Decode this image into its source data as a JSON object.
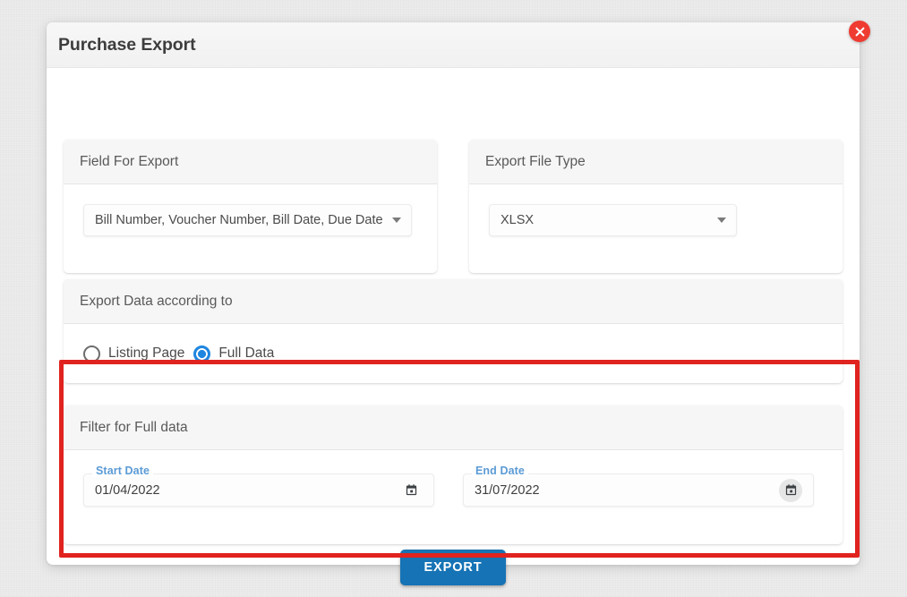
{
  "dialog": {
    "title": "Purchase Export",
    "close_icon": "close-icon"
  },
  "field_for_export": {
    "header": "Field For Export",
    "selected": "Bill Number, Voucher Number, Bill Date, Due Date",
    "caret_icon": "chevron-down-icon"
  },
  "export_file_type": {
    "header": "Export File Type",
    "selected": "XLSX",
    "caret_icon": "chevron-down-icon"
  },
  "export_data_according_to": {
    "header": "Export Data according to",
    "options": [
      {
        "label": "Listing Page",
        "selected": false
      },
      {
        "label": "Full Data",
        "selected": true
      }
    ]
  },
  "filter_for_full_data": {
    "header": "Filter for Full data",
    "start_date": {
      "label": "Start Date",
      "value": "01/04/2022",
      "icon": "calendar-icon"
    },
    "end_date": {
      "label": "End Date",
      "value": "31/07/2022",
      "icon": "calendar-icon"
    }
  },
  "actions": {
    "export_label": "EXPORT"
  },
  "colors": {
    "accent_blue": "#1673b5",
    "radio_blue": "#1f86e0",
    "label_blue": "#5b9bd5",
    "close_red": "#ef3b31",
    "annotation_red": "#e0231f"
  }
}
